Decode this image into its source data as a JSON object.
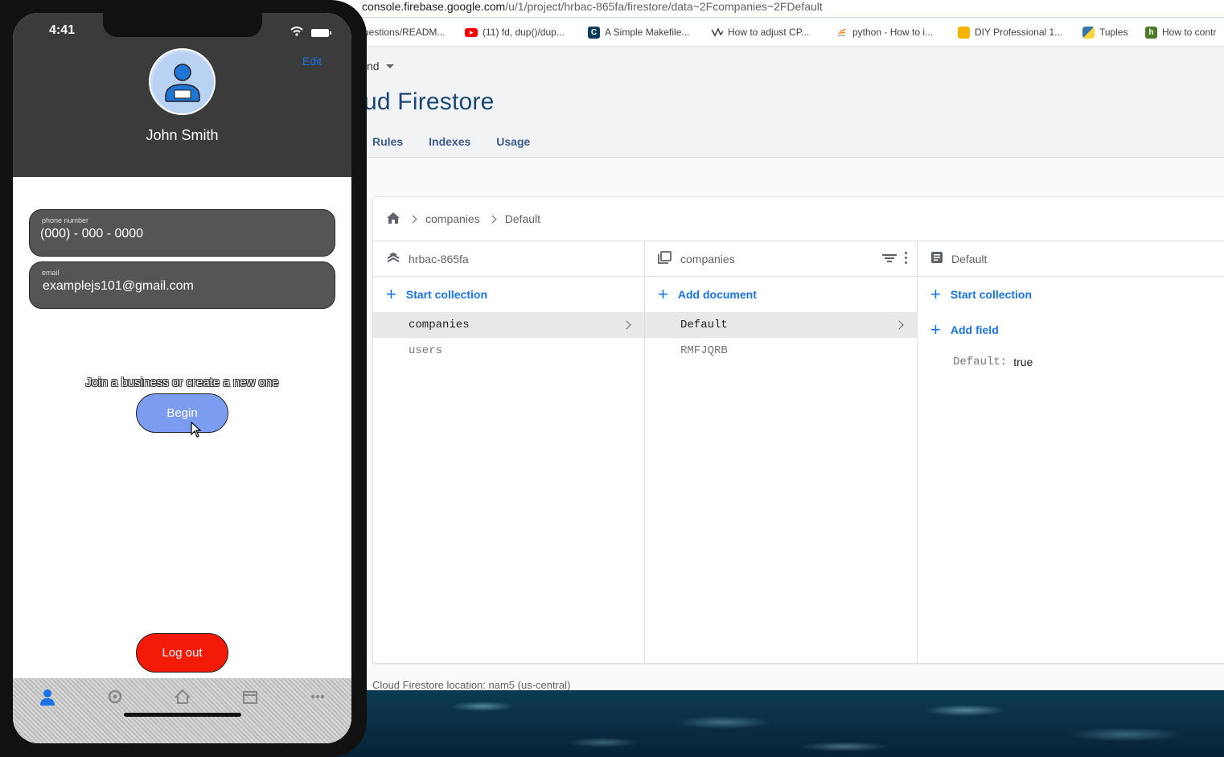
{
  "browser": {
    "url_domain": "console.firebase.google.com",
    "url_path": "/u/1/project/hrbac-865fa/firestore/data~2Fcompanies~2FDefault",
    "bookmarks": [
      {
        "label": "uestions/READM...",
        "icon": "document-icon",
        "color": "#9aa0a6"
      },
      {
        "label": "(11) fd, dup()/dup...",
        "icon": "youtube-icon",
        "color": "#ff0000"
      },
      {
        "label": "A Simple Makefile...",
        "icon": "c-logo-icon",
        "color": "#0c3c5a"
      },
      {
        "label": "How to adjust CP...",
        "icon": "chart-icon",
        "color": "#3c4043"
      },
      {
        "label": "python - How to i...",
        "icon": "stack-icon",
        "color": "#f48024"
      },
      {
        "label": "DIY Professional 1...",
        "icon": "diy-icon",
        "color": "#e8710a"
      },
      {
        "label": "Tuples",
        "icon": "python-icon",
        "color": "#3776ab"
      },
      {
        "label": "How to contr",
        "icon": "h-icon",
        "color": "#4a7b2a"
      }
    ]
  },
  "console": {
    "project_selector": "nd",
    "title": "ud Firestore",
    "tabs": [
      "Rules",
      "Indexes",
      "Usage"
    ],
    "breadcrumb": [
      "companies",
      "Default"
    ],
    "columns": [
      {
        "header": "hrbac-865fa",
        "action": "Start collection",
        "rows": [
          {
            "label": "companies",
            "selected": true
          },
          {
            "label": "users",
            "selected": false
          }
        ]
      },
      {
        "header": "companies",
        "action": "Add document",
        "rows": [
          {
            "label": "Default",
            "selected": true
          },
          {
            "label": "RMFJQRB",
            "selected": false
          }
        ]
      },
      {
        "header": "Default",
        "action": "Start collection",
        "action2": "Add field",
        "fields": [
          {
            "key": "Default:",
            "value": "true"
          }
        ]
      }
    ],
    "location": "Cloud Firestore location: nam5 (us-central)"
  },
  "phone": {
    "time": "4:41",
    "edit": "Edit",
    "user_name": "John Smith",
    "phone_label": "phone number",
    "phone_value": "(000) - 000 - 0000",
    "email_label": "email",
    "email_value": "examplejs101@gmail.com",
    "join_text": "Join a business or create a new one",
    "begin": "Begin",
    "logout": "Log out",
    "tab_icons": [
      "person-icon",
      "settings-icon",
      "home-icon",
      "calendar-icon",
      "more-icon"
    ]
  },
  "colors": {
    "accent": "#1a73e8",
    "begin_button": "#7b9cf1",
    "logout_button": "#f31a08",
    "phone_header": "#3b3b3b"
  }
}
